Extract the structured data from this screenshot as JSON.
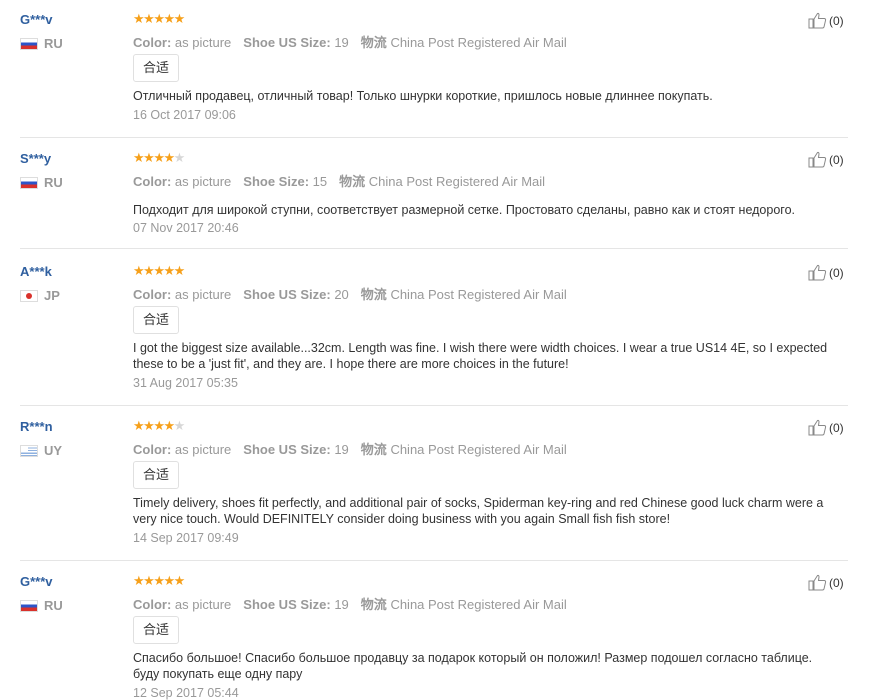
{
  "labels": {
    "color": "Color:",
    "shoe_us_size": "Shoe US Size:",
    "shoe_size": "Shoe Size:",
    "shipping": "物流"
  },
  "reviews": [
    {
      "user": "G***v",
      "country": "RU",
      "rating": 5,
      "color_value": "as picture",
      "size_label_key": "shoe_us_size",
      "size_value": "19",
      "shipping_value": "China Post Registered Air Mail",
      "tag": "合适",
      "text": "Отличный продавец, отличный товар! Только шнурки короткие, пришлось новые длиннее покупать.",
      "date": "16 Oct 2017 09:06",
      "helpful": "(0)"
    },
    {
      "user": "S***y",
      "country": "RU",
      "rating": 4,
      "color_value": "as picture",
      "size_label_key": "shoe_size",
      "size_value": "15",
      "shipping_value": "China Post Registered Air Mail",
      "tag": "",
      "text": "Подходит для широкой ступни, соответствует размерной сетке. Простовато сделаны, равно как и стоят недорого.",
      "date": "07 Nov 2017 20:46",
      "helpful": "(0)"
    },
    {
      "user": "A***k",
      "country": "JP",
      "rating": 5,
      "color_value": "as picture",
      "size_label_key": "shoe_us_size",
      "size_value": "20",
      "shipping_value": "China Post Registered Air Mail",
      "tag": "合适",
      "text": "I got the biggest size available...32cm. Length was fine. I wish there were width choices. I wear a true US14 4E, so I expected these to be a 'just fit', and they are. I hope there are more choices in the future!",
      "date": "31 Aug 2017 05:35",
      "helpful": "(0)"
    },
    {
      "user": "R***n",
      "country": "UY",
      "rating": 4,
      "color_value": "as picture",
      "size_label_key": "shoe_us_size",
      "size_value": "19",
      "shipping_value": "China Post Registered Air Mail",
      "tag": "合适",
      "text": "Timely delivery, shoes fit perfectly, and additional pair of socks, Spiderman key-ring and red Chinese good luck charm were a very nice touch. Would DEFINITELY consider doing business with you again Small fish fish store!",
      "date": "14 Sep 2017 09:49",
      "helpful": "(0)"
    },
    {
      "user": "G***v",
      "country": "RU",
      "rating": 5,
      "color_value": "as picture",
      "size_label_key": "shoe_us_size",
      "size_value": "19",
      "shipping_value": "China Post Registered Air Mail",
      "tag": "合适",
      "text": "Спасибо большое! Спасибо большое продавцу за подарок который он положил! Размер подошел согласно таблице. буду покупать еще одну пару",
      "date": "12 Sep 2017 05:44",
      "helpful": "(0)"
    }
  ],
  "colors": {
    "star_on": "#f6a01a",
    "star_off": "#d7d7d7",
    "user_link": "#2f5f9f",
    "muted": "#999999"
  }
}
